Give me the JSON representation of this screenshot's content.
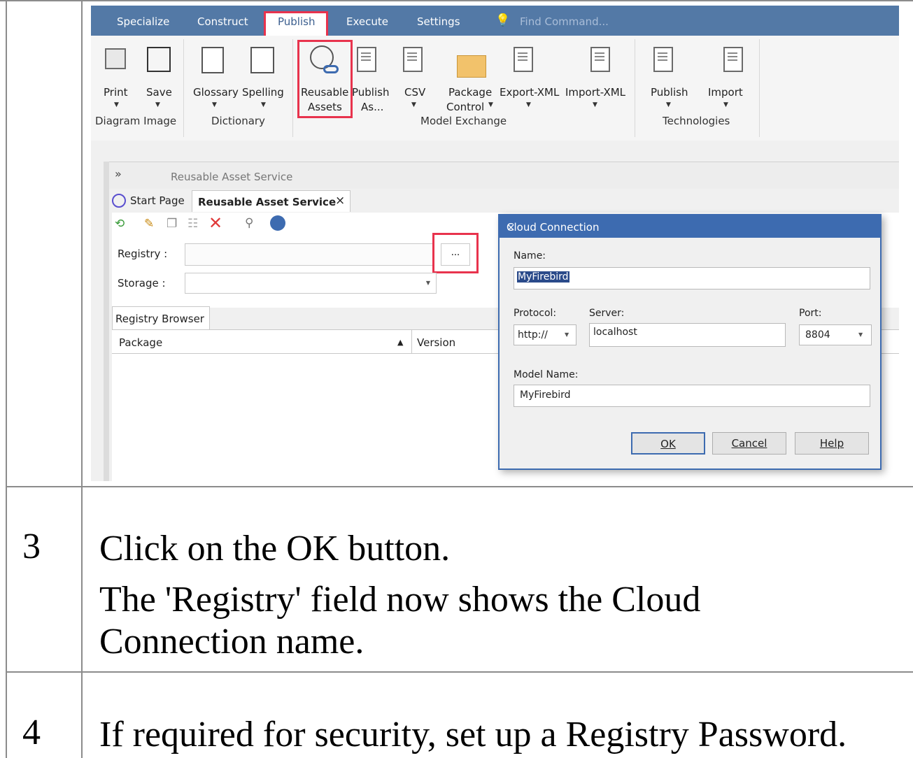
{
  "menu": {
    "items": [
      "Specialize",
      "Construct",
      "Publish",
      "Execute",
      "Settings"
    ],
    "find_command": "Find Command..."
  },
  "ribbon": {
    "buttons": {
      "print": "Print",
      "save": "Save",
      "glossary": "Glossary",
      "spelling": "Spelling",
      "reusable_1": "Reusable",
      "reusable_2": "Assets",
      "publish_as_1": "Publish",
      "publish_as_2": "As...",
      "csv": "CSV",
      "package_1": "Package",
      "package_2": "Control",
      "export_xml": "Export-XML",
      "import_xml": "Import-XML",
      "publish": "Publish",
      "import": "Import"
    },
    "groups": {
      "diagram_image": "Diagram Image",
      "dictionary": "Dictionary",
      "model_exchange": "Model Exchange",
      "technologies": "Technologies"
    }
  },
  "panel": {
    "header": "Reusable Asset Service",
    "header_chevron": "»",
    "tabs": [
      "Start Page",
      "Reusable Asset Service"
    ],
    "tab_close": "×",
    "registry_label": "Registry :",
    "storage_label": "Storage :",
    "browse_button": "...",
    "browser_tab": "Registry Browser",
    "col_package": "Package",
    "col_version": "Version"
  },
  "dialog": {
    "title": "Cloud Connection",
    "close": "×",
    "name_label": "Name:",
    "name_value": "MyFirebird",
    "protocol_label": "Protocol:",
    "protocol_value": "http://",
    "server_label": "Server:",
    "server_value": "localhost",
    "port_label": "Port:",
    "port_value": "8804",
    "model_name_label": "Model Name:",
    "model_name_value": "MyFirebird",
    "ok": "OK",
    "cancel": "Cancel",
    "help": "Help"
  },
  "steps": [
    {
      "number": "3",
      "lines": [
        "Click on the OK button.",
        "The 'Registry' field now shows the Cloud",
        "Connection name."
      ]
    },
    {
      "number": "4",
      "lines": [
        "If required for security, set up a Registry Password."
      ]
    }
  ],
  "colors": {
    "menubar": "#5379a6",
    "highlight": "#e8334d",
    "dialog_title": "#3d6bb0"
  }
}
